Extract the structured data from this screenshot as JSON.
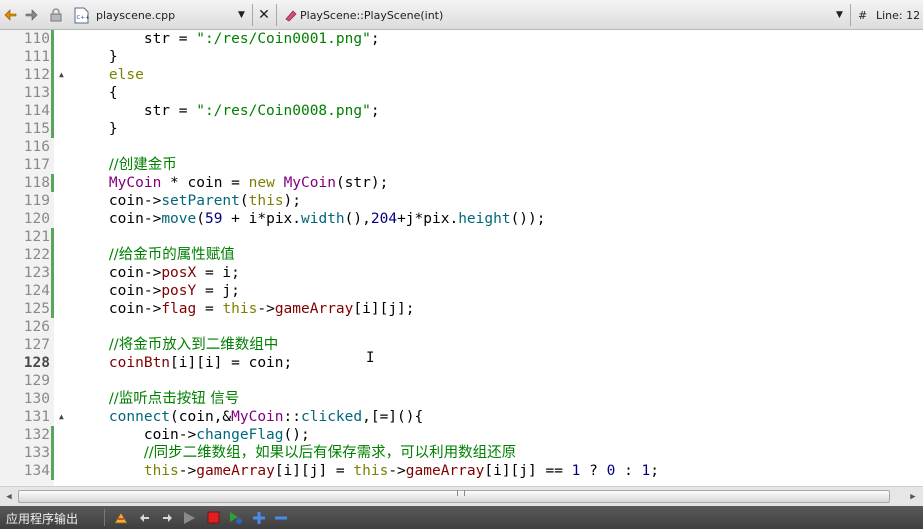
{
  "toolbar": {
    "file_name": "playscene.cpp",
    "symbol": "PlayScene::PlayScene(int)",
    "hash": "#",
    "line_info": "Line: 12"
  },
  "editor": {
    "current_line": "128",
    "lines": [
      {
        "n": "110",
        "mod": true,
        "fold": "",
        "tokens": [
          [
            "        str = ",
            "plain"
          ],
          [
            "\":/res/Coin0001.png\"",
            "str"
          ],
          [
            ";",
            "plain"
          ]
        ]
      },
      {
        "n": "111",
        "mod": true,
        "fold": "",
        "tokens": [
          [
            "    }",
            "plain"
          ]
        ]
      },
      {
        "n": "112",
        "mod": true,
        "fold": "▲",
        "tokens": [
          [
            "    ",
            "plain"
          ],
          [
            "else",
            "kw"
          ]
        ]
      },
      {
        "n": "113",
        "mod": true,
        "fold": "",
        "tokens": [
          [
            "    {",
            "plain"
          ]
        ]
      },
      {
        "n": "114",
        "mod": true,
        "fold": "",
        "tokens": [
          [
            "        str = ",
            "plain"
          ],
          [
            "\":/res/Coin0008.png\"",
            "str"
          ],
          [
            ";",
            "plain"
          ]
        ]
      },
      {
        "n": "115",
        "mod": true,
        "fold": "",
        "tokens": [
          [
            "    }",
            "plain"
          ]
        ]
      },
      {
        "n": "116",
        "mod": false,
        "fold": "",
        "tokens": []
      },
      {
        "n": "117",
        "mod": false,
        "fold": "",
        "tokens": [
          [
            "    ",
            "plain"
          ],
          [
            "//创建金币",
            "cmt"
          ]
        ]
      },
      {
        "n": "118",
        "mod": true,
        "fold": "",
        "tokens": [
          [
            "    ",
            "plain"
          ],
          [
            "MyCoin",
            "cls"
          ],
          [
            " * coin = ",
            "plain"
          ],
          [
            "new",
            "kw"
          ],
          [
            " ",
            "plain"
          ],
          [
            "MyCoin",
            "cls"
          ],
          [
            "(str);",
            "plain"
          ]
        ]
      },
      {
        "n": "119",
        "mod": false,
        "fold": "",
        "tokens": [
          [
            "    coin->",
            "plain"
          ],
          [
            "setParent",
            "fn"
          ],
          [
            "(",
            "plain"
          ],
          [
            "this",
            "kw"
          ],
          [
            ");",
            "plain"
          ]
        ]
      },
      {
        "n": "120",
        "mod": false,
        "fold": "",
        "tokens": [
          [
            "    coin->",
            "plain"
          ],
          [
            "move",
            "fn"
          ],
          [
            "(",
            "plain"
          ],
          [
            "59",
            "num"
          ],
          [
            " + i*pix.",
            "plain"
          ],
          [
            "width",
            "fn"
          ],
          [
            "(),",
            "plain"
          ],
          [
            "204",
            "num"
          ],
          [
            "+j*pix.",
            "plain"
          ],
          [
            "height",
            "fn"
          ],
          [
            "());",
            "plain"
          ]
        ]
      },
      {
        "n": "121",
        "mod": true,
        "fold": "",
        "tokens": []
      },
      {
        "n": "122",
        "mod": true,
        "fold": "",
        "tokens": [
          [
            "    ",
            "plain"
          ],
          [
            "//给金币的属性赋值",
            "cmt"
          ]
        ]
      },
      {
        "n": "123",
        "mod": true,
        "fold": "",
        "tokens": [
          [
            "    coin->",
            "plain"
          ],
          [
            "posX",
            "mem"
          ],
          [
            " = i;",
            "plain"
          ]
        ]
      },
      {
        "n": "124",
        "mod": true,
        "fold": "",
        "tokens": [
          [
            "    coin->",
            "plain"
          ],
          [
            "posY",
            "mem"
          ],
          [
            " = j;",
            "plain"
          ]
        ]
      },
      {
        "n": "125",
        "mod": true,
        "fold": "",
        "tokens": [
          [
            "    coin->",
            "plain"
          ],
          [
            "flag",
            "mem"
          ],
          [
            " = ",
            "plain"
          ],
          [
            "this",
            "kw"
          ],
          [
            "->",
            "plain"
          ],
          [
            "gameArray",
            "mem"
          ],
          [
            "[i][j];",
            "plain"
          ]
        ]
      },
      {
        "n": "126",
        "mod": false,
        "fold": "",
        "tokens": []
      },
      {
        "n": "127",
        "mod": false,
        "fold": "",
        "tokens": [
          [
            "    ",
            "plain"
          ],
          [
            "//将金币放入到二维数组中",
            "cmt"
          ]
        ]
      },
      {
        "n": "128",
        "mod": false,
        "fold": "",
        "tokens": [
          [
            "    ",
            "plain"
          ],
          [
            "coinBtn",
            "mem"
          ],
          [
            "[i][i] = coin;",
            "plain"
          ]
        ]
      },
      {
        "n": "129",
        "mod": false,
        "fold": "",
        "tokens": []
      },
      {
        "n": "130",
        "mod": false,
        "fold": "",
        "tokens": [
          [
            "    ",
            "plain"
          ],
          [
            "//监听点击按钮 信号",
            "cmt"
          ]
        ]
      },
      {
        "n": "131",
        "mod": false,
        "fold": "▲",
        "tokens": [
          [
            "    ",
            "plain"
          ],
          [
            "connect",
            "fn"
          ],
          [
            "(coin,&",
            "plain"
          ],
          [
            "MyCoin",
            "cls"
          ],
          [
            "::",
            "plain"
          ],
          [
            "clicked",
            "fn"
          ],
          [
            ",[=](){",
            "plain"
          ]
        ]
      },
      {
        "n": "132",
        "mod": true,
        "fold": "",
        "tokens": [
          [
            "        coin->",
            "plain"
          ],
          [
            "changeFlag",
            "fn"
          ],
          [
            "();",
            "plain"
          ]
        ]
      },
      {
        "n": "133",
        "mod": true,
        "fold": "",
        "tokens": [
          [
            "        ",
            "plain"
          ],
          [
            "//同步二维数组，如果以后有保存需求，可以利用数组还原",
            "cmt"
          ]
        ]
      },
      {
        "n": "134",
        "mod": true,
        "fold": "",
        "tokens": [
          [
            "        ",
            "plain"
          ],
          [
            "this",
            "kw"
          ],
          [
            "->",
            "plain"
          ],
          [
            "gameArray",
            "mem"
          ],
          [
            "[i][j] = ",
            "plain"
          ],
          [
            "this",
            "kw"
          ],
          [
            "->",
            "plain"
          ],
          [
            "gameArray",
            "mem"
          ],
          [
            "[i][j] == ",
            "plain"
          ],
          [
            "1",
            "num"
          ],
          [
            " ? ",
            "plain"
          ],
          [
            "0",
            "num"
          ],
          [
            " : ",
            "plain"
          ],
          [
            "1",
            "num"
          ],
          [
            ";",
            "plain"
          ]
        ]
      }
    ]
  },
  "output_bar": {
    "title": "应用程序输出"
  },
  "colors": {
    "keyword": "#808000",
    "string": "#008000",
    "class": "#800080",
    "member": "#800000",
    "number": "#000080",
    "function": "#00677c",
    "modified_marker": "#5aa55a"
  },
  "icons": [
    "back-arrow-icon",
    "forward-arrow-icon",
    "lock-icon",
    "cpp-file-icon",
    "close-icon",
    "symbol-icon",
    "chevron-down-icon",
    "clear-icon",
    "up-icon",
    "down-icon",
    "run-icon",
    "stop-icon",
    "rerun-icon",
    "zoom-in-icon",
    "zoom-out-icon"
  ]
}
